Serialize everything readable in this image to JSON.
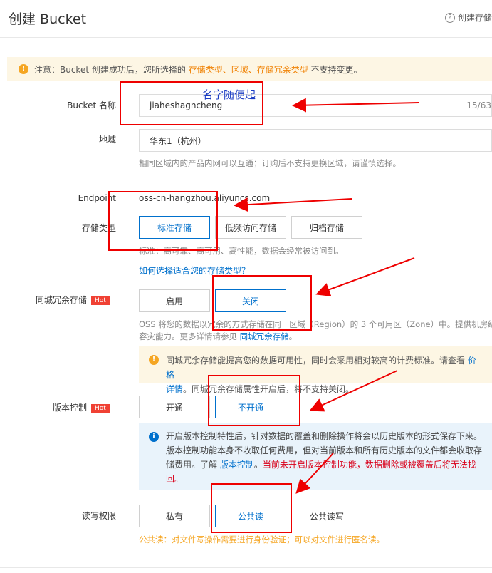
{
  "header": {
    "title": "创建 Bucket",
    "help_label": "创建存储"
  },
  "notice": {
    "prefix": "注意：Bucket 创建成功后，您所选择的 ",
    "highlight": "存储类型、区域、存储冗余类型",
    "suffix": " 不支持变更。"
  },
  "bucket_name": {
    "label": "Bucket 名称",
    "value": "jiaheshagncheng",
    "count": "15/63"
  },
  "region": {
    "label": "地域",
    "value": "华东1（杭州）",
    "hint": "相同区域内的产品内网可以互通；订购后不支持更换区域，请谨慎选择。"
  },
  "endpoint": {
    "label": "Endpoint",
    "value": "oss-cn-hangzhou.aliyuncs.com"
  },
  "storage_type": {
    "label": "存储类型",
    "options": [
      "标准存储",
      "低频访问存储",
      "归档存储"
    ],
    "hint": "标准：高可靠、高可用、高性能，数据会经常被访问到。",
    "link": "如何选择适合您的存储类型？"
  },
  "zone_redundancy": {
    "label": "同城冗余存储",
    "hot": "Hot",
    "options": [
      "启用",
      "关闭"
    ],
    "hint_line1": "OSS 将您的数据以冗余的方式存储在同一区域（Region）的 3 个可用区（Zone）中。提供机房级",
    "hint_line2_prefix": "容灾能力。更多详情请参见 ",
    "hint_link": "同城冗余存储",
    "hint_line2_suffix": "。",
    "alert_line1_prefix": "同城冗余存储能提高您的数据可用性，同时会采用相对较高的计费标准。请查看 ",
    "alert_link1": "价格",
    "alert_link2": "详情",
    "alert_line2_suffix": "。同城冗余存储属性开启后，将不支持关闭。"
  },
  "versioning": {
    "label": "版本控制",
    "hot": "Hot",
    "options": [
      "开通",
      "不开通"
    ],
    "info_line1": "开启版本控制特性后，针对数据的覆盖和删除操作将会以历史版本的形式保存下来。",
    "info_line2": "版本控制功能本身不收取任何费用，但对当前版本和所有历史版本的文件都会收取存",
    "info_line3_prefix": "储费用。了解 ",
    "info_link": "版本控制",
    "info_line3_mid": "。",
    "info_warn_a": "当前未开启版本控制功能，数据删除或被覆盖后将无法找",
    "info_warn_b": "回。"
  },
  "acl": {
    "label": "读写权限",
    "options": [
      "私有",
      "公共读",
      "公共读写"
    ],
    "hint": "公共读：对文件写操作需要进行身份验证；可以对文件进行匿名读。"
  },
  "annotation": {
    "text": "名字随便起"
  },
  "colors": {
    "accent": "#0070cc",
    "warning": "#f08000",
    "annotation_red": "#e00000"
  }
}
